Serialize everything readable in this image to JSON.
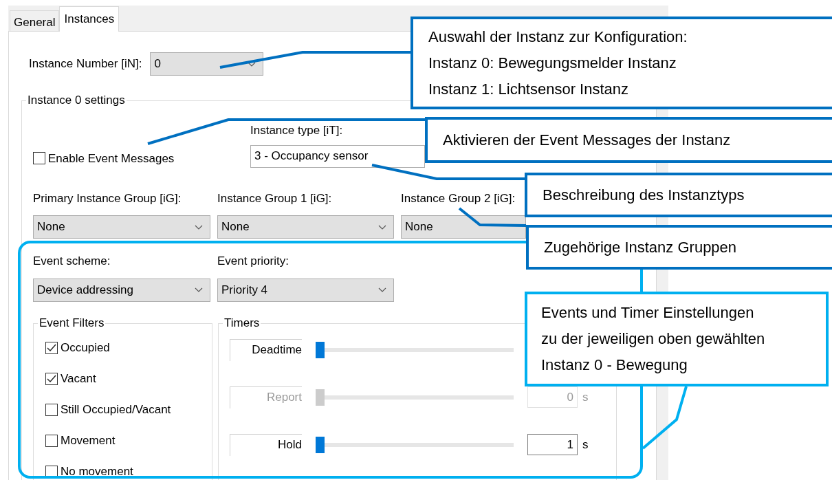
{
  "tabs": [
    {
      "label": "General",
      "selected": false
    },
    {
      "label": "Instances",
      "selected": true
    }
  ],
  "instance_number": {
    "label": "Instance Number [iN]:",
    "value": "0"
  },
  "settings": {
    "title": "Instance 0 settings",
    "enable_event_messages": {
      "label": "Enable Event Messages",
      "checked": false
    },
    "instance_type": {
      "label": "Instance type [iT]:",
      "value": "3 - Occupancy sensor"
    },
    "groups": [
      {
        "label": "Primary Instance Group [iG]:",
        "value": "None"
      },
      {
        "label": "Instance Group 1 [iG]:",
        "value": "None"
      },
      {
        "label": "Instance Group 2 [iG]:",
        "value": "None"
      }
    ],
    "event_scheme": {
      "label": "Event scheme:",
      "value": "Device addressing"
    },
    "event_priority": {
      "label": "Event priority:",
      "value": "Priority 4"
    },
    "event_filters": {
      "title": "Event Filters",
      "items": [
        {
          "label": "Occupied",
          "checked": true
        },
        {
          "label": "Vacant",
          "checked": true
        },
        {
          "label": "Still Occupied/Vacant",
          "checked": false
        },
        {
          "label": "Movement",
          "checked": false
        },
        {
          "label": "No movement",
          "checked": false
        }
      ]
    },
    "timers": {
      "title": "Timers",
      "rows": [
        {
          "label": "Deadtime",
          "level": 0,
          "disabled": false
        },
        {
          "label": "Report",
          "level": 0,
          "disabled": true,
          "value": "0",
          "unit": "s"
        },
        {
          "label": "Hold",
          "level": 0,
          "disabled": false,
          "value": "1",
          "unit": "s"
        }
      ]
    }
  },
  "callouts": [
    {
      "kind": "dark",
      "lines": [
        "Auswahl der Instanz zur Konfiguration:",
        "Instanz 0: Bewegungsmelder Instanz",
        "Instanz 1: Lichtsensor Instanz"
      ]
    },
    {
      "kind": "dark",
      "lines": [
        "Aktivieren der Event Messages der Instanz"
      ]
    },
    {
      "kind": "dark",
      "lines": [
        "Beschreibung des Instanztyps"
      ]
    },
    {
      "kind": "dark",
      "lines": [
        "Zugehörige Instanz Gruppen"
      ]
    },
    {
      "kind": "cyan",
      "lines": [
        "Events und Timer Einstellungen",
        "zu der jeweiligen oben gewählten",
        "Instanz 0 - Bewegung"
      ]
    }
  ]
}
